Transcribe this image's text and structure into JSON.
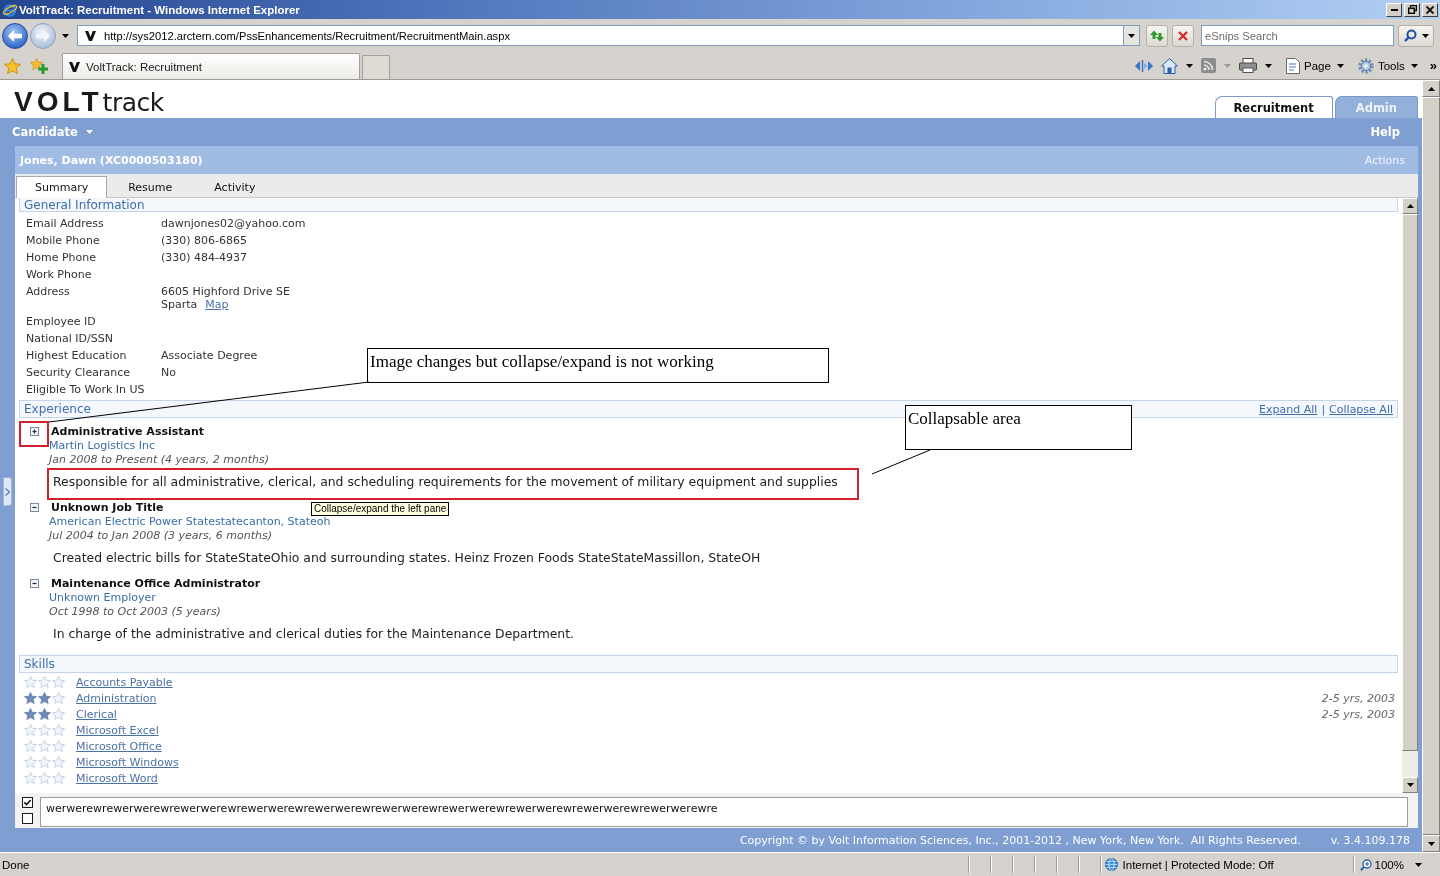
{
  "window": {
    "title": "VoltTrack: Recruitment - Windows Internet Explorer"
  },
  "address_bar": {
    "url": "http://sys2012.arctern.com/PssEnhancements/Recruitment/RecruitmentMain.aspx"
  },
  "search": {
    "placeholder": "eSnips Search"
  },
  "browser_tabs": [
    {
      "label": "VoltTrack: Recruitment",
      "selected": true
    }
  ],
  "command_bar": {
    "page": "Page",
    "tools": "Tools",
    "overflow": "»"
  },
  "app": {
    "logo": {
      "bold": "VOLT",
      "light": "track"
    },
    "tabs": [
      {
        "label": "Recruitment",
        "selected": true
      },
      {
        "label": "Admin",
        "selected": false
      }
    ],
    "menu": "Candidate",
    "help": "Help"
  },
  "record": {
    "title": "Jones, Dawn (XC0000503180)",
    "actions": "Actions",
    "tabs": [
      {
        "label": "Summary",
        "selected": true
      },
      {
        "label": "Resume",
        "selected": false
      },
      {
        "label": "Activity",
        "selected": false
      }
    ]
  },
  "general_information": {
    "heading": "General Information",
    "fields": [
      {
        "label": "Email Address",
        "value": "dawnjones02@yahoo.com"
      },
      {
        "label": "Mobile Phone",
        "value": "(330) 806-6865"
      },
      {
        "label": "Home Phone",
        "value": "(330) 484-4937"
      },
      {
        "label": "Work Phone"
      },
      {
        "label": "Address",
        "value": "6605 Highford Drive SE",
        "line_2": "Sparta",
        "link": "Map"
      },
      {
        "label": "Employee ID"
      },
      {
        "label": "National ID/SSN"
      },
      {
        "label": "Highest Education",
        "value": "Associate Degree"
      },
      {
        "label": "Security Clearance",
        "value": "No"
      },
      {
        "label": "Eligible To Work In US"
      }
    ]
  },
  "experience": {
    "heading": "Experience",
    "expand_all": "Expand All",
    "separator": "|",
    "collapse_all": "Collapse All",
    "jobs": [
      {
        "title": "Administrative Assistant",
        "company": "Martin Logistics Inc",
        "dates": "Jan 2008 to Present (4 years, 2 months)",
        "description": "Responsible for all administrative, clerical, and scheduling requirements for the movement of military equipment and supplies",
        "expanded": false
      },
      {
        "title": "Unknown Job Title",
        "company": "American Electric Power Statestatecanton, Stateoh",
        "dates": "Jul 2004 to Jan 2008 (3 years, 6 months)",
        "description": "Created electric bills for StateStateOhio and surrounding states. Heinz Frozen Foods StateStateMassillon, StateOH",
        "expanded": true
      },
      {
        "title": "Maintenance Office Administrator",
        "company": "Unknown Employer",
        "dates": "Oct 1998 to Oct 2003 (5 years)",
        "description": "In charge of the administrative and clerical duties for the Maintenance Department.",
        "expanded": true
      }
    ]
  },
  "skills": {
    "heading": "Skills",
    "items": [
      {
        "name": "Accounts Payable",
        "stars": 0
      },
      {
        "name": "Administration",
        "stars": 2,
        "detail": "2-5 yrs, 2003"
      },
      {
        "name": "Clerical",
        "stars": 2,
        "detail": "2-5 yrs, 2003"
      },
      {
        "name": "Microsoft Excel",
        "stars": 0
      },
      {
        "name": "Microsoft Office",
        "stars": 0
      },
      {
        "name": "Microsoft Windows",
        "stars": 0
      },
      {
        "name": "Microsoft Word",
        "stars": 0
      }
    ]
  },
  "notes": {
    "checkboxes": [
      {
        "checked": true
      },
      {
        "checked": false
      }
    ],
    "value": "werwerewrewerwerewrewerwerewrewerwerewrewerwerewrewerwerewrewerwerewrewerwerewrewerwerewrewerwerewre"
  },
  "footer": {
    "copyright": "Copyright © by Volt Information Sciences, Inc., 2001-2012 , New York, New York.  All Rights Reserved.",
    "version": "v. 3.4.109.178"
  },
  "status_bar": {
    "text": "Done",
    "zone": "Internet | Protected Mode: Off",
    "zoom": "100%"
  },
  "tooltip": {
    "text": "Collapse/expand the left pane"
  },
  "annotations": [
    {
      "kind": "callout",
      "text": "Image changes but collapse/expand is not working"
    },
    {
      "kind": "callout",
      "text": "Collapsable area"
    }
  ]
}
